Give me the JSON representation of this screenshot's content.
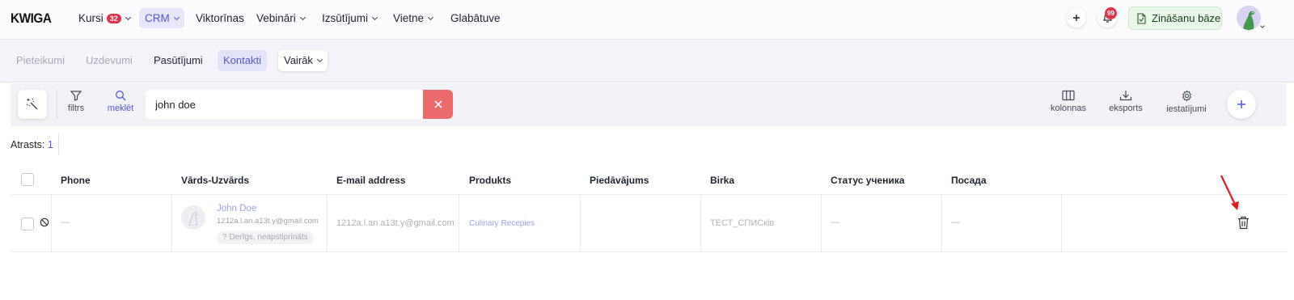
{
  "brand": {
    "logo": "KWIGA"
  },
  "nav": {
    "items": [
      {
        "label": "Kursi",
        "badge": "32",
        "dropdown": true
      },
      {
        "label": "CRM",
        "dropdown": true,
        "active": true
      },
      {
        "label": "Viktorīnas"
      },
      {
        "label": "Vebināri",
        "dropdown": true
      },
      {
        "label": "Izsūtījumi",
        "dropdown": true
      },
      {
        "label": "Vietne",
        "dropdown": true
      },
      {
        "label": "Glabātuve"
      }
    ],
    "add_icon": "plus-icon",
    "notifications_count": "99",
    "knowledge_base_label": "Zināšanu bāze"
  },
  "subnav": {
    "items": [
      {
        "label": "Pieteikumi"
      },
      {
        "label": "Uzdevumi"
      },
      {
        "label": "Pasūtījumi"
      },
      {
        "label": "Kontakti"
      },
      {
        "label": "Vairāk"
      }
    ]
  },
  "toolbar": {
    "filter_label": "filtrs",
    "search_label": "meklēt",
    "search_value": "john doe",
    "columns_label": "kolonnas",
    "export_label": "eksports",
    "settings_label": "iestatījumi"
  },
  "results": {
    "label": "Atrasts:",
    "count": "1"
  },
  "table": {
    "headers": [
      "Phone",
      "Vārds-Uzvārds",
      "E-mail address",
      "Produkts",
      "Piedāvājums",
      "Birka",
      "Статус ученика",
      "Посада"
    ],
    "rows": [
      {
        "phone": "—",
        "name": "John Doe",
        "name_email": "1212a.l.an.a13t.y@gmail.com",
        "status_pill": "?   Derīgs, neapstiprināts",
        "email": "1212a.l.an.a13t.y@gmail.com",
        "product": "Culinary Recepies",
        "offer": "",
        "tag": "ТЕСТ_СПИСків",
        "student_status": "—",
        "position": "—"
      }
    ]
  },
  "colors": {
    "accent": "#4e57d8",
    "danger": "#ec6a6a",
    "badge": "#e0324b",
    "kb_bg": "#e9f7e9"
  }
}
